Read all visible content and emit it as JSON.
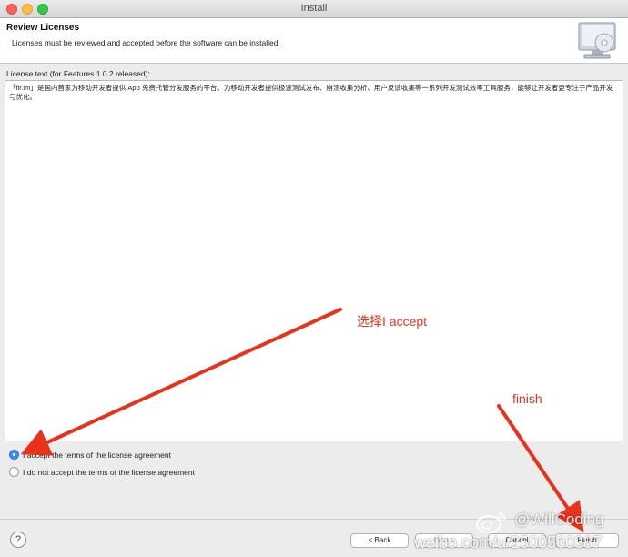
{
  "window": {
    "title": "Install"
  },
  "header": {
    "title": "Review Licenses",
    "description": "Licenses must be reviewed and accepted before the software can be installed."
  },
  "license": {
    "label": "License text (for Features 1.0.2.released):",
    "text": "「fir.im」是国内首家为移动开发者提供 App 免费托管分发服务的平台。为移动开发者提供极速测试发布、崩溃收集分析、用户反馈收集等一系列开发测试效率工具服务，能够让开发者更专注于产品开发与优化。"
  },
  "options": [
    {
      "label": "I accept the terms of the license agreement",
      "checked": true
    },
    {
      "label": "I do not accept the terms of the license agreement",
      "checked": false
    }
  ],
  "buttons": {
    "help": "?",
    "back": "< Back",
    "next": "Next >",
    "cancel": "Cancel",
    "finish": "Finish"
  },
  "annotations": {
    "accept_hint": "选择I accept",
    "finish_hint": "finish",
    "color": "#e8321c"
  },
  "watermark": {
    "handle": "@WillCoding",
    "url": "weibo.com/u/2500560387"
  }
}
